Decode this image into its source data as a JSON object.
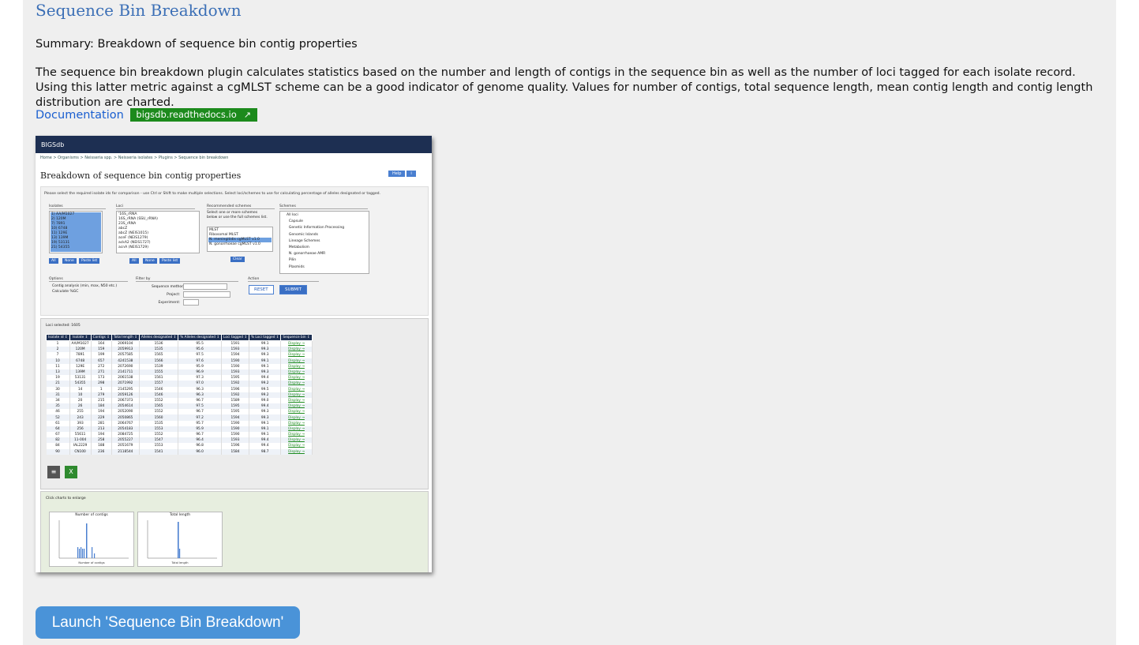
{
  "page": {
    "title": "Sequence Bin Breakdown",
    "summary": "Summary: Breakdown of sequence bin contig properties",
    "description": "The sequence bin breakdown plugin calculates statistics based on the number and length of contigs in the sequence bin as well as the number of loci tagged for each isolate record. Using this latter metric against a cgMLST scheme can be a good indicator of genome quality. Values for number of contigs, total sequence length, mean contig length and contig length distribution are charted.",
    "doc_label": "Documentation",
    "doc_badge": "bigsdb.readthedocs.io",
    "launch_label": "Launch 'Sequence Bin Breakdown'"
  },
  "colors": {
    "accent": "#3b6fb6",
    "badge": "#1c8a1c",
    "launch": "#4a93d8",
    "header": "#1d2f52"
  },
  "preview": {
    "app": "BIGSdb",
    "breadcrumb": "Home > Organisms > Neisseria spp. > Neisseria isolates > Plugins > Sequence bin breakdown",
    "help": "Help",
    "heading": "Breakdown of sequence bin contig properties",
    "instructions": "Please select the required isolate ids for comparison - use Ctrl or Shift to make multiple selections. Select loci/schemes to use for calculating percentage of alleles designated or tagged.",
    "labels": {
      "isolates": "Isolates",
      "loci": "Loci",
      "recommended": "Recommended schemes",
      "schemes": "Schemes",
      "options": "Options",
      "filter": "Filter by",
      "action": "Action"
    },
    "isolates_list": "1) AA/M1027\n2) 120M\n7) 7891\n10) 6748\n11) 129E\n13) 139M\n19) 53131\n21) 54355",
    "loci_list": "'16S_rRNA\n16S_rRNA (SSU_rRNA)\n23S_rRNA\nabcZ\nabcZ (NEIS1015)\naceF (NEIS1279)\nackA2 (NEIS1727)\nacnA (NEIS1729)",
    "recommended_hint": "Select one or more schemes\nbelow or use the full schemes list.",
    "recommended_list": "MLST\nRibosomal MLST\nN. meningitidis cgMLST v1.0\nN. gonorrhoeae cgMLST v1.0",
    "schemes_list": "All loci\n  Capsule\n  Genetic Information Processing\n  Genomic Islands\n  Lineage Schemes\n  Metabolism\n  N. gonorrhoeae AMR\n  Pilin\n  Plasmids",
    "options_list": "Contig analysis (min, max, N50 etc.)\nCalculate %GC",
    "filter_list": "Sequence method:\nProject:\nExperiment:",
    "btn_all": "All",
    "btn_none": "None",
    "btn_paste": "Paste list",
    "btn_clear": "Clear",
    "btn_reset": "RESET",
    "btn_submit": "SUBMIT",
    "loci_selected": "Loci selected: 1605",
    "table_headers": [
      "Isolate id",
      "Isolate",
      "Contigs",
      "Total length",
      "Alleles designated",
      "% Alleles designated",
      "Loci tagged",
      "% Loci tagged",
      "Sequence bin"
    ],
    "table_rows": [
      [
        "1",
        "AA/M1027",
        "164",
        "2069104",
        "1536",
        "95.5",
        "1591",
        "99.1",
        "Display"
      ],
      [
        "2",
        "120M",
        "159",
        "2059913",
        "1535",
        "95.6",
        "1593",
        "99.3",
        "Display"
      ],
      [
        "7",
        "7891",
        "199",
        "2057585",
        "1565",
        "97.5",
        "1594",
        "99.3",
        "Display"
      ],
      [
        "10",
        "6748",
        "657",
        "4241538",
        "1566",
        "97.6",
        "1590",
        "99.1",
        "Display"
      ],
      [
        "11",
        "129E",
        "272",
        "2072690",
        "1539",
        "95.9",
        "1590",
        "99.1",
        "Display"
      ],
      [
        "13",
        "139M",
        "271",
        "2141711",
        "1555",
        "96.9",
        "1593",
        "99.3",
        "Display"
      ],
      [
        "19",
        "53131",
        "173",
        "2061538",
        "1561",
        "97.3",
        "1595",
        "99.4",
        "Display"
      ],
      [
        "21",
        "54355",
        "298",
        "2071992",
        "1557",
        "97.0",
        "1592",
        "99.2",
        "Display"
      ],
      [
        "30",
        "14",
        "1",
        "2145295",
        "1546",
        "96.3",
        "1596",
        "99.5",
        "Display"
      ],
      [
        "31",
        "10",
        "279",
        "2059126",
        "1546",
        "96.3",
        "1592",
        "99.2",
        "Display"
      ],
      [
        "34",
        "20",
        "215",
        "2067373",
        "1552",
        "96.7",
        "1589",
        "99.0",
        "Display"
      ],
      [
        "35",
        "26",
        "184",
        "2054614",
        "1565",
        "97.5",
        "1595",
        "99.4",
        "Display"
      ],
      [
        "46",
        "255",
        "194",
        "2052090",
        "1552",
        "96.7",
        "1595",
        "99.3",
        "Display"
      ],
      [
        "52",
        "243",
        "229",
        "2050865",
        "1560",
        "97.2",
        "1594",
        "99.3",
        "Display"
      ],
      [
        "61",
        "393",
        "281",
        "2064767",
        "1535",
        "95.7",
        "1590",
        "99.1",
        "Display"
      ],
      [
        "64",
        "256",
        "213",
        "2054183",
        "1553",
        "95.9",
        "1590",
        "99.1",
        "Display"
      ],
      [
        "67",
        "55611",
        "194",
        "2084725",
        "1552",
        "96.7",
        "1590",
        "99.1",
        "Display"
      ],
      [
        "82",
        "11-004",
        "258",
        "2055227",
        "1547",
        "96.4",
        "1593",
        "99.4",
        "Display"
      ],
      [
        "84",
        "IAL2229",
        "188",
        "2051679",
        "1553",
        "96.8",
        "1596",
        "99.4",
        "Display"
      ],
      [
        "90",
        "CN100",
        "236",
        "2118544",
        "1541",
        "96.0",
        "1584",
        "98.7",
        "Display"
      ]
    ],
    "charts_hint": "Click charts to enlarge",
    "chart1_title": "Number of contigs",
    "chart1_x": "Number of contigs",
    "chart2_title": "Total length",
    "chart2_x": "Total length"
  }
}
